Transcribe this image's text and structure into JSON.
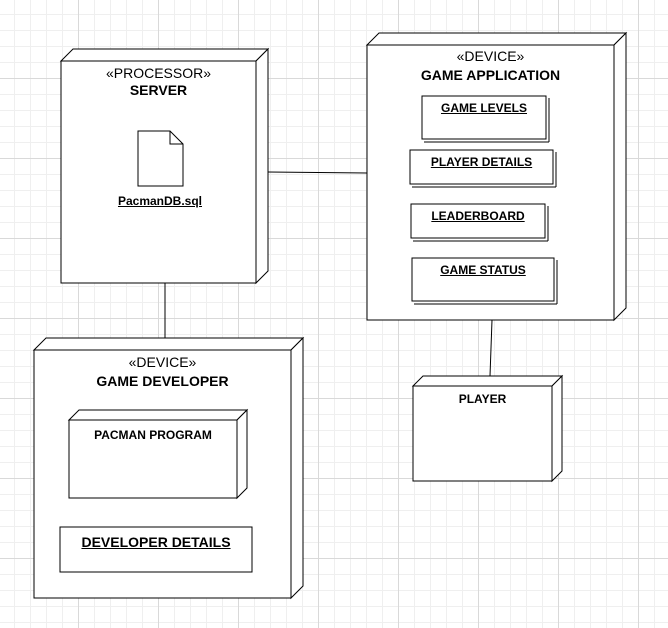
{
  "server": {
    "stereotype": "«PROCESSOR»",
    "title": "SERVER",
    "artifact_label": "PacmanDB.sql"
  },
  "game_application": {
    "stereotype": "«DEVICE»",
    "title": "GAME APPLICATION",
    "components": [
      "GAME LEVELS",
      "PLAYER DETAILS",
      "LEADERBOARD",
      "GAME STATUS"
    ]
  },
  "game_developer": {
    "stereotype": "«DEVICE»",
    "title": "GAME DEVELOPER",
    "program_node": "PACMAN PROGRAM",
    "details": "DEVELOPER DETAILS"
  },
  "player": {
    "title": "PLAYER"
  },
  "style": {
    "stroke_color": "#000000",
    "fill_color": "#ffffff",
    "grid_color": "#d9d9d9"
  }
}
